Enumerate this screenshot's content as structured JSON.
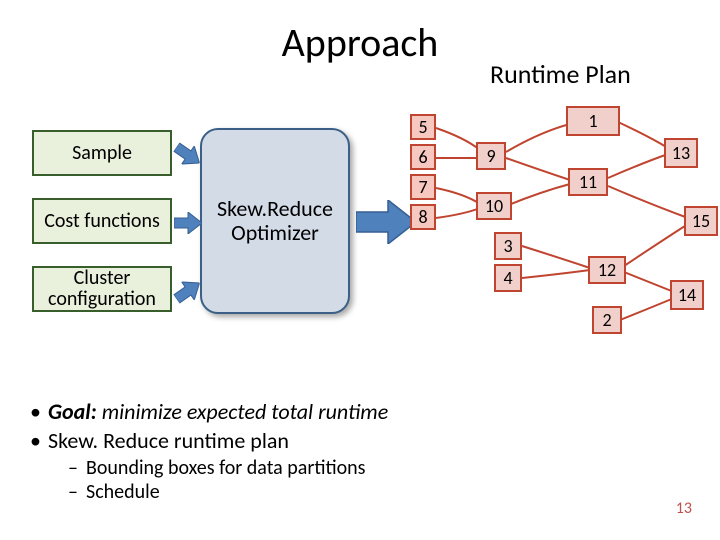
{
  "title": "Approach",
  "subtitle": "Runtime Plan",
  "inputs": {
    "sample": "Sample",
    "cost": "Cost functions",
    "cluster": "Cluster configuration"
  },
  "optimizer": "Skew.Reduce Optimizer",
  "tree": {
    "leaves": [
      "5",
      "6",
      "7",
      "8"
    ],
    "nodes": {
      "l2a": "9",
      "l2b": "10",
      "l2c": "3",
      "l2d": "4",
      "l3a": "1",
      "l3b": "11",
      "l3c": "12",
      "l3d": "2",
      "l4a": "13",
      "l4b": "15",
      "l4c": "14"
    }
  },
  "bullets": {
    "goal_label": "Goal:",
    "goal_text": " minimize expected total runtime",
    "plan_text": "Skew. Reduce runtime plan",
    "sub1": "Bounding boxes for data partitions",
    "sub2": "Schedule"
  },
  "pagenum": "13",
  "chart_data": {
    "type": "diagram",
    "title": "Approach — SkewReduce Optimizer produces a Runtime Plan (tree)",
    "inputs_to_optimizer": [
      "Sample",
      "Cost functions",
      "Cluster configuration"
    ],
    "optimizer": "Skew.Reduce Optimizer",
    "output": "Runtime Plan",
    "tree_edges": [
      [
        5,
        9
      ],
      [
        6,
        9
      ],
      [
        7,
        10
      ],
      [
        8,
        10
      ],
      [
        9,
        1
      ],
      [
        9,
        11
      ],
      [
        10,
        11
      ],
      [
        3,
        12
      ],
      [
        4,
        12
      ],
      [
        1,
        13
      ],
      [
        11,
        13
      ],
      [
        11,
        15
      ],
      [
        12,
        15
      ],
      [
        12,
        14
      ],
      [
        2,
        14
      ]
    ],
    "tree_leaves": [
      5,
      6,
      7,
      8,
      3,
      4,
      2
    ],
    "tree_internal": [
      9,
      10,
      1,
      11,
      12,
      13,
      15,
      14
    ]
  }
}
